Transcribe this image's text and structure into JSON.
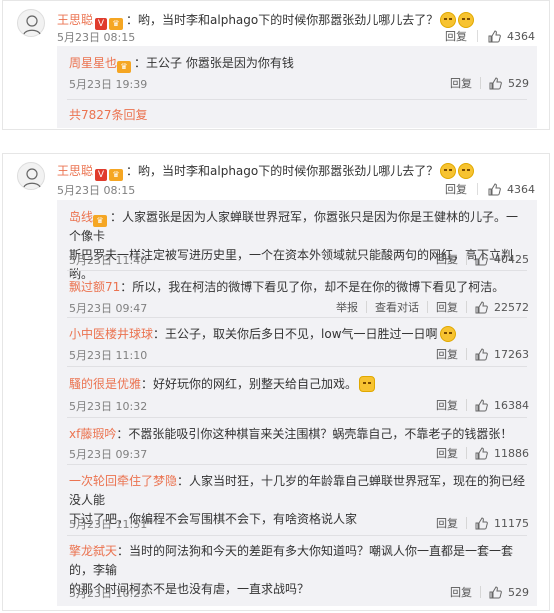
{
  "card1": {
    "user": "王思聪",
    "text": "：哟，当时李和alphago下的时候你那嚣张劲儿哪儿去了？",
    "time": "5月23日 08:15",
    "reply_label": "回复",
    "likes": "4364",
    "sub": {
      "user": "周星星也",
      "text": "：王公子 你嚣张是因为你有钱",
      "time": "5月23日 19:39",
      "reply_label": "回复",
      "likes": "529"
    },
    "more": "共7827条回复"
  },
  "card2": {
    "user": "王思聪",
    "text": "：哟，当时李和alphago下的时候你那嚣张劲儿哪儿去了？",
    "time": "5月23日 08:15",
    "reply_label": "回复",
    "likes": "4364",
    "replies": [
      {
        "user": "岛线",
        "text_line1": "：人家嚣张是因为人家蝉联世界冠军，你嚣张只是因为你是王健林的儿子。一个像卡",
        "text_line2": "斯巴罗夫一样注定被写进历史里，一个在资本外领域就只能酸两句的网红，高下立判哟。",
        "time": "5月23日 11:40",
        "reply_label": "回复",
        "likes": "40425"
      },
      {
        "user": "飘过额71",
        "text_line1": "：所以，我在柯洁的微博下看见了你，却不是在你的微博下看见了柯洁。",
        "text_line2": "",
        "time": "5月23日 09:47",
        "report": "举报",
        "view_conv": "查看对话",
        "reply_label": "回复",
        "likes": "22572"
      },
      {
        "user": "小中医楼井球球",
        "text_line1": "：王公子，取关你后多日不见，low气一日胜过一日啊",
        "text_line2": "",
        "time": "5月23日 11:10",
        "reply_label": "回复",
        "likes": "17263"
      },
      {
        "user": "騷的很是优雅",
        "text_line1": "：好好玩你的网红，别整天给自己加戏。",
        "text_line2": "",
        "time": "5月23日 10:32",
        "reply_label": "回复",
        "likes": "16384"
      },
      {
        "user": "xf藤瑕吟",
        "text_line1": "：不嚣张能吸引你这种棋盲来关注围棋？蜗壳靠自己，不靠老子的钱嚣张！",
        "text_line2": "",
        "time": "5月23日 09:37",
        "reply_label": "回复",
        "likes": "11886"
      },
      {
        "user": "一次轮回牵住了梦隐",
        "text_line1": "：人家当时狂，十几岁的年龄靠自己蝉联世界冠军，现在的狗已经没人能",
        "text_line2": "下过了吧，你编程不会写围棋不会下，有啥资格说人家",
        "time": "5月23日 11:51",
        "reply_label": "回复",
        "likes": "11175"
      },
      {
        "user": "擎龙弑天",
        "text_line1": "：当时的阿法狗和今天的差距有多大你知道吗？嘲讽人你一直都是一套一套的，李输",
        "text_line2": "的那个时间柯杰不是也没有虐，一直求战吗？",
        "time": "5月23日 10:23",
        "reply_label": "回复",
        "likes": "529"
      }
    ]
  }
}
